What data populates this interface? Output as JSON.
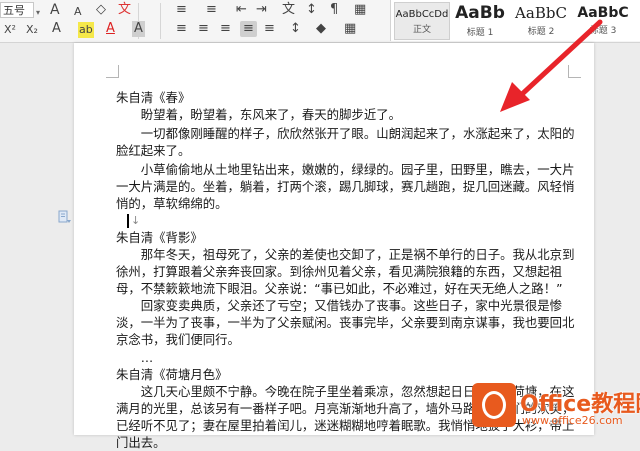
{
  "toolbar": {
    "font_size_value": "五号",
    "row1": {
      "font_size_dropdown": "▾",
      "grow_font": "A",
      "shrink_font": "A",
      "clear_format": "◇",
      "format_painter": "文",
      "bullets": "≡",
      "numbering": "≡",
      "decrease_indent": "⇤",
      "increase_indent": "⇥",
      "chinese_layout": "文",
      "sort": "↕",
      "show_marks": "¶",
      "borders": "▦"
    },
    "row2": {
      "superscript": "X²",
      "subscript": "X₂",
      "text_effect": "A",
      "highlight": "ab",
      "font_color": "A",
      "char_shading": "A",
      "align_left": "≡",
      "align_center": "≡",
      "align_right": "≡",
      "justify": "≡",
      "distributed": "≡",
      "line_spacing": "↕",
      "shading": "◆",
      "border": "▦"
    }
  },
  "styles": [
    {
      "sample": "AaBbCcDd",
      "label": "正文"
    },
    {
      "sample": "AaBb",
      "label": "标题 1"
    },
    {
      "sample": "AaBbC",
      "label": "标题 2"
    },
    {
      "sample": "AaBbC",
      "label": "标题 3"
    }
  ],
  "document": {
    "sec1_title": "朱自清《春》",
    "sec1_p1": "盼望着，盼望着，东风来了，春天的脚步近了。",
    "sec1_p2": "一切都像刚睡醒的样子，欣欣然张开了眼。山朗润起来了，水涨起来了，太阳的脸红起来了。",
    "sec1_p3": "小草偷偷地从土地里钻出来，嫩嫩的，绿绿的。园子里，田野里，瞧去，一大片一大片满是的。坐着，躺着，打两个滚，踢几脚球，赛几趟跑，捉几回迷藏。风轻悄悄的，草软绵绵的。",
    "para_mark": "↓",
    "sec2_title": "朱自清《背影》",
    "sec2_p1": "那年冬天，祖母死了，父亲的差使也交卸了，正是祸不单行的日子。我从北京到徐州，打算跟着父亲奔丧回家。到徐州见着父亲，看见满院狼籍的东西，又想起祖母，不禁簌簌地流下眼泪。父亲说：“事已如此，不必难过，好在天无绝人之路！”",
    "sec2_p2": "回家变卖典质，父亲还了亏空；又借钱办了丧事。这些日子，家中光景很是惨淡，一半为了丧事，一半为了父亲赋闲。丧事完毕，父亲要到南京谋事，我也要回北京念书，我们便同行。",
    "ellipsis": "…",
    "sec3_title": "朱自清《荷塘月色》",
    "sec3_p1": "这几天心里颇不宁静。今晚在院子里坐着乘凉，忽然想起日日走过的荷塘，在这满月的光里，总该另有一番样子吧。月亮渐渐地升高了，墙外马路上孩子们的欢笑，已经听不见了；妻在屋里拍着闰儿，迷迷糊糊地哼着眠歌。我悄悄地披了大衫，带上门出去。"
  },
  "watermark": {
    "title": "Office教程网",
    "url": "www.office26.com"
  },
  "colors": {
    "arrow": "#e8242a",
    "watermark": "#e85a1e"
  }
}
